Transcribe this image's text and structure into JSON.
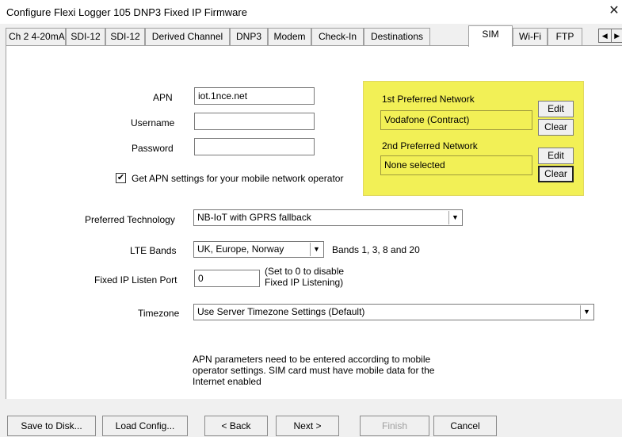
{
  "window": {
    "title": "Configure Flexi Logger 105 DNP3 Fixed IP Firmware",
    "close_glyph": "✕"
  },
  "tabs": [
    {
      "label": "Ch 2 4-20mA"
    },
    {
      "label": "SDI-12"
    },
    {
      "label": "SDI-12"
    },
    {
      "label": "Derived Channel"
    },
    {
      "label": "DNP3"
    },
    {
      "label": "Modem"
    },
    {
      "label": "Check-In"
    },
    {
      "label": "Destinations"
    },
    {
      "label": "SIM",
      "active": true
    },
    {
      "label": "Wi-Fi"
    },
    {
      "label": "FTP"
    }
  ],
  "tab_scroll": {
    "left": "◀",
    "right": "▶"
  },
  "sim": {
    "apn_label": "APN",
    "apn_value": "iot.1nce.net",
    "username_label": "Username",
    "username_value": "",
    "password_label": "Password",
    "password_value": "",
    "get_apn_label": "Get APN settings for your mobile network operator",
    "get_apn_checked": true,
    "check_glyph": "✔",
    "pref_tech_label": "Preferred Technology",
    "pref_tech_value": "NB-IoT with GPRS fallback",
    "lte_bands_label": "LTE Bands",
    "lte_bands_value": "UK, Europe, Norway",
    "lte_bands_note": "Bands 1, 3, 8 and 20",
    "listen_port_label": "Fixed IP Listen Port",
    "listen_port_value": "0",
    "listen_port_note_1": "(Set to 0 to disable",
    "listen_port_note_2": "Fixed IP Listening)",
    "timezone_label": "Timezone",
    "timezone_value": "Use Server Timezone Settings (Default)",
    "info_line_1": "APN parameters need to be entered according to mobile",
    "info_line_2": "operator settings.  SIM card must have mobile data for the",
    "info_line_3": "Internet enabled",
    "dropdown_glyph": "▼"
  },
  "networks": {
    "first_label": "1st Preferred Network",
    "first_value": "Vodafone (Contract)",
    "second_label": "2nd Preferred Network",
    "second_value": "None selected",
    "edit_label": "Edit",
    "clear_label": "Clear",
    "highlight_color": "#f2f056"
  },
  "footer": {
    "save_label": "Save to Disk...",
    "load_label": "Load Config...",
    "back_label": "< Back",
    "next_label": "Next >",
    "finish_label": "Finish",
    "cancel_label": "Cancel"
  }
}
